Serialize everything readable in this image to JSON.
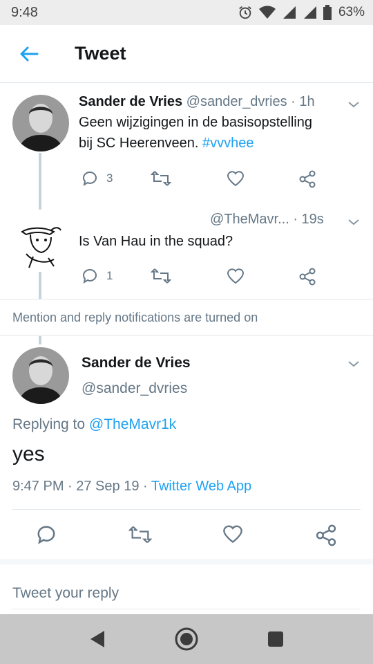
{
  "status": {
    "time": "9:48",
    "battery": "63%"
  },
  "header": {
    "title": "Tweet"
  },
  "thread": [
    {
      "name": "Sander de Vries",
      "handle": "@sander_dvries",
      "age": "· 1h",
      "text_lines": [
        "Geen wijzigingen in de basisopstelling",
        "bij SC Heerenveen. "
      ],
      "hashtag": "#vvvhee",
      "reply_count": "3"
    },
    {
      "handle": "@TheMavr...",
      "age": "· 19s",
      "text": "Is Van Hau in the squad?",
      "reply_count": "1"
    }
  ],
  "notification": "Mention and reply notifications are turned on",
  "focus": {
    "name": "Sander de Vries",
    "handle": "@sander_dvries",
    "replying_prefix": "Replying to ",
    "replying_to": "@TheMavr1k",
    "text": "yes",
    "meta": "9:47 PM · 27 Sep 19 · ",
    "source": "Twitter Web App"
  },
  "reply_box": {
    "placeholder": "Tweet your reply"
  },
  "colors": {
    "accent": "#1da1f2",
    "muted": "#657786",
    "text": "#14171a"
  },
  "icons": [
    "back-arrow-icon",
    "reply-icon",
    "retweet-icon",
    "like-icon",
    "share-icon",
    "chevron-down-icon",
    "alarm-icon",
    "wifi-icon",
    "signal-icon",
    "battery-icon"
  ]
}
